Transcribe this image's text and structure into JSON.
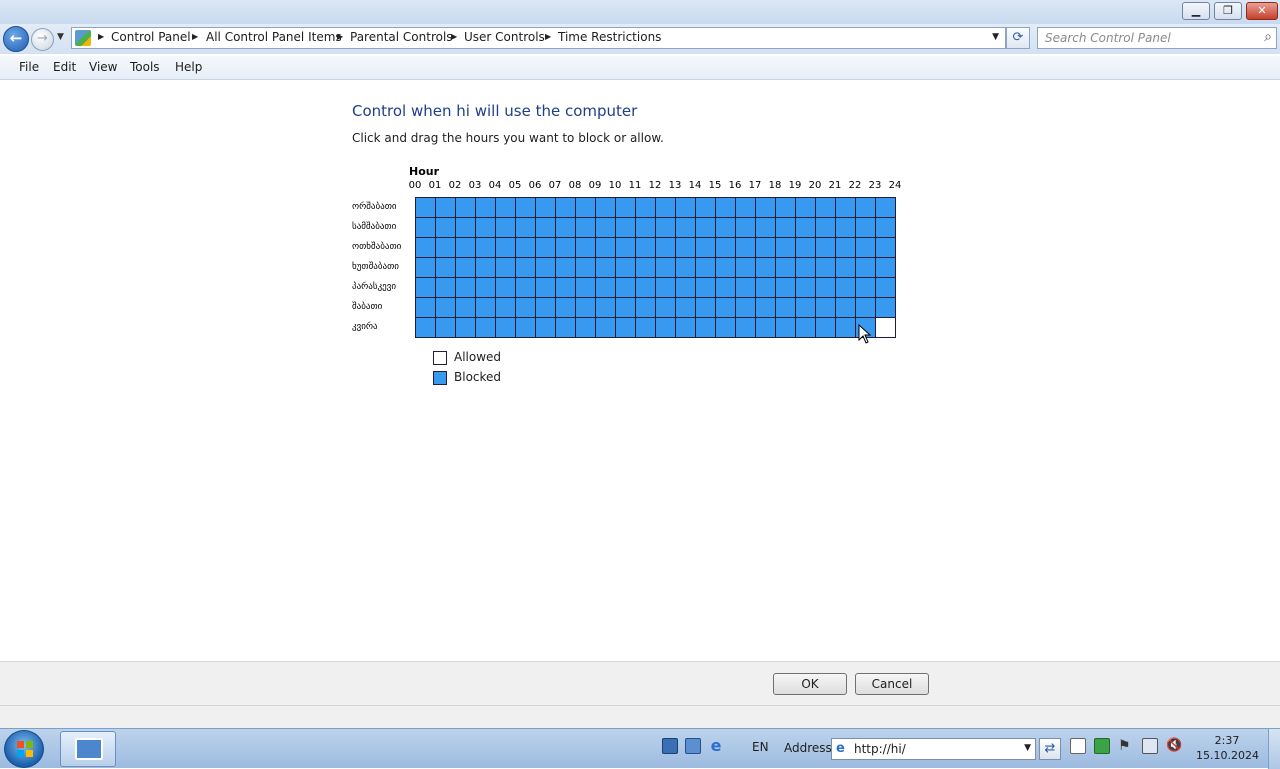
{
  "window": {
    "minimize_glyph": "▁",
    "maximize_glyph": "❐",
    "close_glyph": "✕"
  },
  "nav": {
    "back_glyph": "←",
    "forward_glyph": "→",
    "breadcrumb": [
      "Control Panel",
      "All Control Panel Items",
      "Parental Controls",
      "User Controls",
      "Time Restrictions"
    ],
    "search_placeholder": "Search Control Panel"
  },
  "menu": {
    "items": [
      "File",
      "Edit",
      "View",
      "Tools",
      "Help"
    ]
  },
  "content": {
    "title": "Control when hi will use the computer",
    "instructions": "Click and drag the hours you want to block or allow.",
    "hour_label": "Hour",
    "hours": [
      "00",
      "01",
      "02",
      "03",
      "04",
      "05",
      "06",
      "07",
      "08",
      "09",
      "10",
      "11",
      "12",
      "13",
      "14",
      "15",
      "16",
      "17",
      "18",
      "19",
      "20",
      "21",
      "22",
      "23",
      "24"
    ],
    "days": [
      "ორშაბათი",
      "სამშაბათი",
      "ოთხშაბათი",
      "ხუთშაბათი",
      "პარასკევი",
      "შაბათი",
      "კვირა"
    ],
    "schedule": [
      "BBBBBBBBBBBBBBBBBBBBBBBB",
      "BBBBBBBBBBBBBBBBBBBBBBBB",
      "BBBBBBBBBBBBBBBBBBBBBBBB",
      "BBBBBBBBBBBBBBBBBBBBBBBB",
      "BBBBBBBBBBBBBBBBBBBBBBBB",
      "BBBBBBBBBBBBBBBBBBBBBBBB",
      "BBBBBBBBBBBBBBBBBBBBBBBA"
    ],
    "legend": {
      "allowed": "Allowed",
      "blocked": "Blocked"
    },
    "colors": {
      "blocked": "#3799f0",
      "allowed": "#ffffff"
    }
  },
  "buttons": {
    "ok": "OK",
    "cancel": "Cancel"
  },
  "taskbar": {
    "language": "EN",
    "address_label": "Address",
    "address_value": "http://hi/",
    "time": "2:37",
    "date": "15.10.2024",
    "tray_icons": [
      "monitor-icon",
      "network-icon",
      "ie-icon",
      "document-icon",
      "security-icon",
      "flag-icon",
      "network-status-icon",
      "volume-muted-icon"
    ]
  }
}
